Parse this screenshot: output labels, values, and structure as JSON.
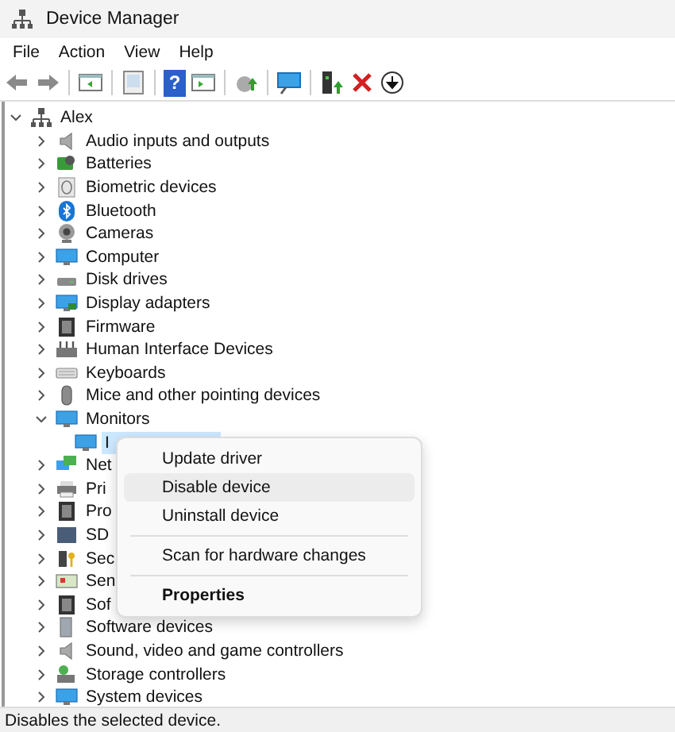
{
  "window": {
    "title": "Device Manager"
  },
  "menu_bar": [
    "File",
    "Action",
    "View",
    "Help"
  ],
  "toolbar": [
    {
      "kind": "back"
    },
    {
      "kind": "forward"
    },
    {
      "kind": "separator"
    },
    {
      "kind": "pane"
    },
    {
      "kind": "separator"
    },
    {
      "kind": "sheet"
    },
    {
      "kind": "separator"
    },
    {
      "kind": "help",
      "glyph": "?"
    },
    {
      "kind": "panel"
    },
    {
      "kind": "separator"
    },
    {
      "kind": "update"
    },
    {
      "kind": "separator"
    },
    {
      "kind": "scan"
    },
    {
      "kind": "separator"
    },
    {
      "kind": "enable"
    },
    {
      "kind": "remove"
    },
    {
      "kind": "download"
    }
  ],
  "tree": {
    "label": "Alex",
    "expanded": true,
    "selected": false,
    "children": [
      {
        "label": "Audio inputs and outputs",
        "expanded": false,
        "selected": false
      },
      {
        "label": "Batteries",
        "expanded": false,
        "selected": false
      },
      {
        "label": "Biometric devices",
        "expanded": false,
        "selected": false
      },
      {
        "label": "Bluetooth",
        "expanded": false,
        "selected": false
      },
      {
        "label": "Cameras",
        "expanded": false,
        "selected": false
      },
      {
        "label": "Computer",
        "expanded": false,
        "selected": false
      },
      {
        "label": "Disk drives",
        "expanded": false,
        "selected": false
      },
      {
        "label": "Display adapters",
        "expanded": false,
        "selected": false
      },
      {
        "label": "Firmware",
        "expanded": false,
        "selected": false
      },
      {
        "label": "Human Interface Devices",
        "expanded": false,
        "selected": false
      },
      {
        "label": "Keyboards",
        "expanded": false,
        "selected": false
      },
      {
        "label": "Mice and other pointing devices",
        "expanded": false,
        "selected": false
      },
      {
        "label": "Monitors",
        "expanded": true,
        "selected": false,
        "children": [
          {
            "label": "I",
            "selected": true
          }
        ]
      },
      {
        "label": "Net",
        "expanded": false,
        "selected": false
      },
      {
        "label": "Pri",
        "expanded": false,
        "selected": false
      },
      {
        "label": "Pro",
        "expanded": false,
        "selected": false
      },
      {
        "label": "SD",
        "expanded": false,
        "selected": false
      },
      {
        "label": "Sec",
        "expanded": false,
        "selected": false
      },
      {
        "label": "Sen",
        "expanded": false,
        "selected": false
      },
      {
        "label": "Sof",
        "expanded": false,
        "selected": false
      },
      {
        "label": "Software devices",
        "expanded": false,
        "selected": false
      },
      {
        "label": "Sound, video and game controllers",
        "expanded": false,
        "selected": false
      },
      {
        "label": "Storage controllers",
        "expanded": false,
        "selected": false
      },
      {
        "label": "System devices",
        "expanded": false,
        "selected": false
      }
    ]
  },
  "context_menu": [
    {
      "kind": "item",
      "label": "Update driver",
      "selected": false
    },
    {
      "kind": "item",
      "label": "Disable device",
      "selected": true
    },
    {
      "kind": "item",
      "label": "Uninstall device",
      "selected": false
    },
    {
      "kind": "separator"
    },
    {
      "kind": "item",
      "label": "Scan for hardware changes",
      "selected": false
    },
    {
      "kind": "separator"
    },
    {
      "kind": "default",
      "label": "Properties",
      "selected": false
    }
  ],
  "status_bar": "Disables the selected device."
}
